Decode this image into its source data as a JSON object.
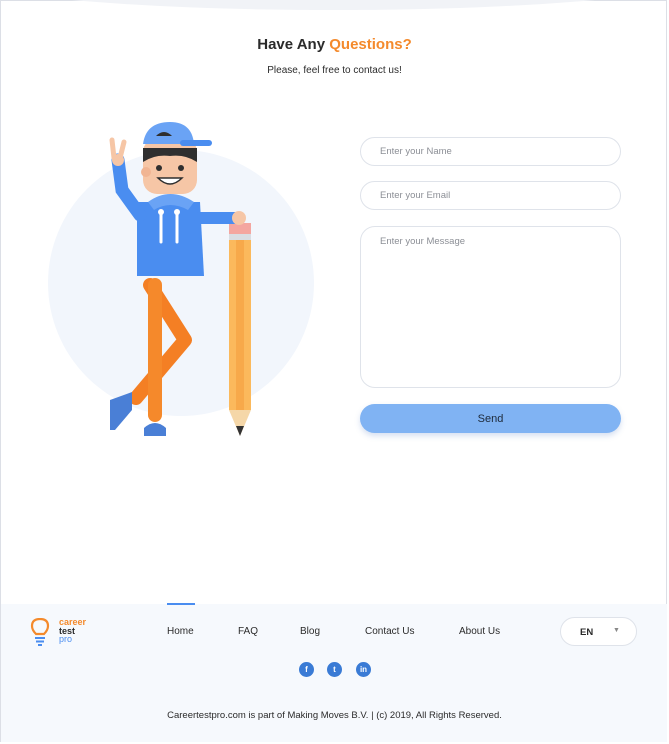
{
  "heading": {
    "prefix": "Have Any",
    "accent": "Questions?"
  },
  "subheading": "Please, feel free to contact us!",
  "form": {
    "name_placeholder": "Enter your Name",
    "email_placeholder": "Enter your Email",
    "message_placeholder": "Enter your Message",
    "send_label": "Send"
  },
  "footer": {
    "logo": {
      "line1": "career",
      "line2": "test",
      "line3": "pro"
    },
    "nav": {
      "home": "Home",
      "faq": "FAQ",
      "blog": "Blog",
      "contact": "Contact Us",
      "about": "About Us"
    },
    "active_nav": "Home",
    "language": "EN",
    "social": {
      "facebook": "f",
      "twitter": "t",
      "linkedin": "in"
    },
    "copyright": "Careertestpro.com is part of Making Moves B.V.  |  (c) 2019, All Rights Reserved."
  },
  "colors": {
    "accent": "#f48a2c",
    "brand_blue": "#4a8df0",
    "button": "#80b3f3"
  }
}
